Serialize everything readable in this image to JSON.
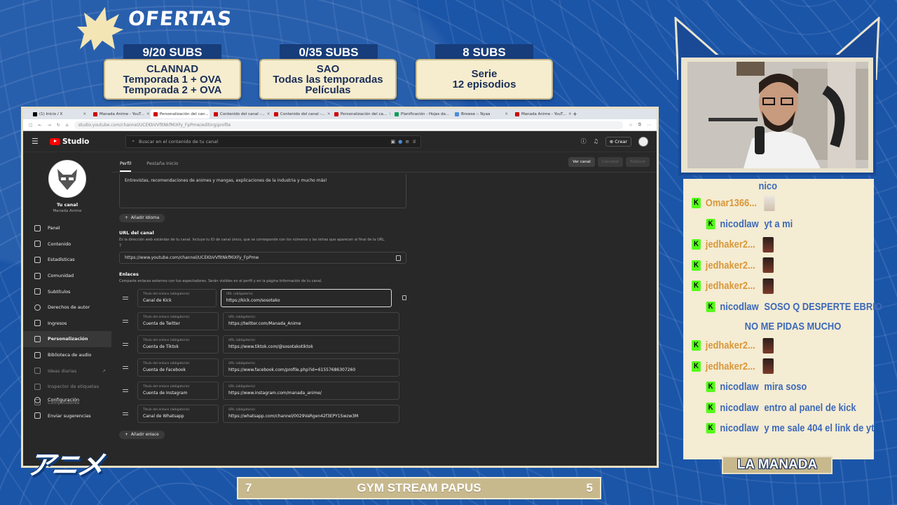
{
  "overlay": {
    "title": "OFERTAS",
    "offers": [
      {
        "tag": "9/20 SUBS",
        "line1": "CLANNAD",
        "line2": "Temporada 1 + OVA",
        "line3": "Temporada 2 + OVA"
      },
      {
        "tag": "0/35 SUBS",
        "line1": "SAO",
        "line2": "Todas las temporadas",
        "line3": "Películas"
      },
      {
        "tag": "8 SUBS",
        "line1": "Serie",
        "line2": "12 episodios",
        "line3": ""
      }
    ],
    "anime_logo": "アニメ",
    "bottom_bar": {
      "left": "7",
      "center": "GYM STREAM PAPUS",
      "right": "5"
    },
    "manada_badge": "LA MANADA"
  },
  "browser": {
    "tabs": [
      {
        "label": "(1) Inicio / X",
        "active": false
      },
      {
        "label": "Manada Anime - YouT...",
        "active": false
      },
      {
        "label": "Personalización del can...",
        "active": true
      },
      {
        "label": "Contenido del canal -...",
        "active": false
      },
      {
        "label": "Contenido del canal -...",
        "active": false
      },
      {
        "label": "Personalización del ca...",
        "active": false
      },
      {
        "label": "Planificación - Hojas de...",
        "active": false
      },
      {
        "label": "Browse :: Nyaa",
        "active": false
      },
      {
        "label": "Manada Anime - YouT...",
        "active": false
      }
    ],
    "url": "studio.youtube.com/channel/UCEKbVVfitNkfMiXFy_FpPmw/editing/profile"
  },
  "studio": {
    "logo_text": "Studio",
    "search_placeholder": "Buscar en el contenido de tu canal",
    "create_label": "Crear",
    "channel": {
      "name": "Tu canal",
      "handle": "Manada Anime"
    },
    "nav": [
      {
        "label": "Panel",
        "icon": "dashboard-icon"
      },
      {
        "label": "Contenido",
        "icon": "content-icon"
      },
      {
        "label": "Estadísticas",
        "icon": "analytics-icon"
      },
      {
        "label": "Comunidad",
        "icon": "community-icon"
      },
      {
        "label": "Subtítulos",
        "icon": "subtitles-icon"
      },
      {
        "label": "Derechos de autor",
        "icon": "copyright-icon"
      },
      {
        "label": "Ingresos",
        "icon": "earn-icon"
      },
      {
        "label": "Personalización",
        "icon": "customization-icon",
        "active": true
      },
      {
        "label": "Biblioteca de audio",
        "icon": "audio-library-icon"
      },
      {
        "label": "Ideas diarias",
        "icon": "ideas-icon",
        "dim": true
      },
      {
        "label": "Inspector de etiquetas",
        "icon": "tag-inspector-icon",
        "dim": true
      },
      {
        "label": "Competidores",
        "icon": "competitors-icon",
        "dim": true
      }
    ],
    "nav_bottom": [
      {
        "label": "Configuración",
        "icon": "settings-icon"
      },
      {
        "label": "Enviar sugerencias",
        "icon": "feedback-icon"
      }
    ],
    "tabs": [
      "Perfil",
      "Pestaña Inicio"
    ],
    "actions": {
      "view": "Ver canal",
      "cancel": "Cancelar",
      "publish": "Publicar"
    },
    "description": "Entrevistas, recomendaciones de animes y mangas, explicaciones de la industria y mucho más!",
    "add_language": "Añadir idioma",
    "url_section": {
      "title": "URL del canal",
      "subtitle": "Es la dirección web estándar de tu canal. Incluye tu ID de canal único, que se corresponde con los números y las letras que aparecen al final de la URL.",
      "value": "https://www.youtube.com/channel/UCEKbVVfitNkfMiXFy_FpPmw"
    },
    "links_section": {
      "title": "Enlaces",
      "subtitle": "Comparte enlaces externos con tus espectadores. Serán visibles en el perfil y en la página Información de tu canal.",
      "title_label": "Título del enlace (obligatorio)",
      "url_label": "URL (obligatorio)",
      "links": [
        {
          "title": "Canal de Kick",
          "url": "https://kick.com/sosotako"
        },
        {
          "title": "Cuenta de Twitter",
          "url": "https://twitter.com/Manada_Anime"
        },
        {
          "title": "Cuenta de Tiktok",
          "url": "https://www.tiktok.com/@sosotakotiktok"
        },
        {
          "title": "Cuenta de Facebook",
          "url": "https://www.facebook.com/profile.php?id=61557686307260"
        },
        {
          "title": "Cuenta de Instagram",
          "url": "https://www.instagram.com/manada_anime/"
        },
        {
          "title": "Canal de Whatsapp",
          "url": "https://whatsapp.com/channel/0029VaRgen42f3EPY1Swzw3M"
        }
      ],
      "add_link": "Añadir enlace"
    }
  },
  "chat": {
    "top_fragment": "nico",
    "messages": [
      {
        "user": "Omar1366...",
        "text": "",
        "user_color": "orange",
        "emote": "dog",
        "reply": false
      },
      {
        "user": "nicodlaw",
        "text": "yt a mi",
        "user_color": "blue",
        "emote": "",
        "reply": true
      },
      {
        "user": "jedhaker2...",
        "text": "",
        "user_color": "orange",
        "emote": "face",
        "reply": false
      },
      {
        "user": "jedhaker2...",
        "text": "",
        "user_color": "orange",
        "emote": "face",
        "reply": false
      },
      {
        "user": "jedhaker2...",
        "text": "",
        "user_color": "orange",
        "emote": "face",
        "reply": false
      },
      {
        "user": "nicodlaw",
        "text": "SOSO Q DESPERTE EBRIO",
        "user_color": "blue",
        "emote": "",
        "reply": true
      },
      {
        "user": "",
        "text": "NO ME PIDAS MUCHO",
        "user_color": "blue",
        "emote": "",
        "reply": false,
        "continuation": true
      },
      {
        "user": "jedhaker2...",
        "text": "",
        "user_color": "orange",
        "emote": "face",
        "reply": false
      },
      {
        "user": "jedhaker2...",
        "text": "",
        "user_color": "orange",
        "emote": "face",
        "reply": false
      },
      {
        "user": "nicodlaw",
        "text": "mira soso",
        "user_color": "blue",
        "emote": "",
        "reply": true
      },
      {
        "user": "nicodlaw",
        "text": "entro al panel de kick",
        "user_color": "blue",
        "emote": "",
        "reply": true
      },
      {
        "user": "nicodlaw",
        "text": "y me sale 404 el link de yt",
        "user_color": "blue",
        "emote": "",
        "reply": true
      }
    ]
  }
}
